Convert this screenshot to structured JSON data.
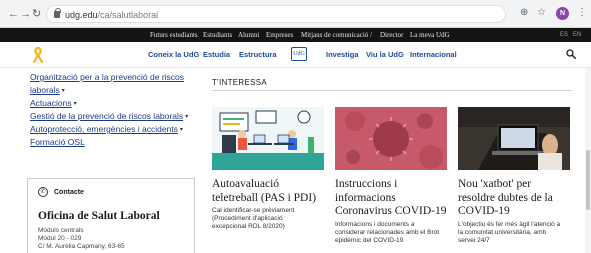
{
  "browser": {
    "back_glyph": "←",
    "forward_glyph": "→",
    "reload_glyph": "↻",
    "url_host": "udg.edu",
    "url_path": "/ca/salutlaboral",
    "zoom_glyph": "⊕",
    "star_glyph": "☆",
    "avatar_letter": "N",
    "menu_glyph": "⋮"
  },
  "topbar": {
    "links": [
      "Futurs estudiants",
      "Estudiants",
      "Alumni",
      "Empreses",
      "Mitjans de comunicació",
      "/",
      "Director",
      "La meva UdG"
    ],
    "lang_es": "ES",
    "lang_en": "EN"
  },
  "mainnav": {
    "links": [
      "Coneix la UdG",
      "Estudia",
      "Estructura",
      "Investiga",
      "Viu la UdG",
      "Internacional"
    ],
    "logo_text": "UdG",
    "ribbon_color": "#f2b51c",
    "link_color": "#1d4a9c"
  },
  "sidebar": {
    "items": [
      "Organització per a la prevenció de riscos",
      "laborals",
      "Actuacions",
      "Gestió de la prevenció de riscos laborals",
      "Autoprotecció, emergències i accidents",
      "Formació OSL"
    ],
    "caret": "▾"
  },
  "contact": {
    "title": "Contacte",
    "name": "Oficina de Salut Laboral",
    "lines": [
      "Mòduls centrals",
      "Mòdul 20 - 029",
      "C/ M. Aurèlia Capmany, 63-65"
    ]
  },
  "main": {
    "section_title": "T'INTERESSA",
    "cards": [
      {
        "title_lines": [
          "Autoavaluació",
          "teletreball (PAS i PDI)"
        ],
        "desc_lines": [
          "Cal identificar-se prèviament",
          "(Procediment d'aplicació",
          "excepcional RDL 8/2020)"
        ]
      },
      {
        "title_lines": [
          "Instruccions i",
          "informacions",
          "Coronavirus COVID-19"
        ],
        "desc_lines": [
          "Informacions i documents a",
          "considerar relacionades amb el Brot",
          "epidèmic del COVID-19"
        ]
      },
      {
        "title_lines": [
          "Nou 'xatbot' per",
          "resoldre dubtes de la",
          "COVID-19"
        ],
        "desc_lines": [
          "L'objectiu és fer més àgil l'atenció a",
          "la comunitat universitària, amb",
          "servei 24/7"
        ]
      }
    ]
  }
}
